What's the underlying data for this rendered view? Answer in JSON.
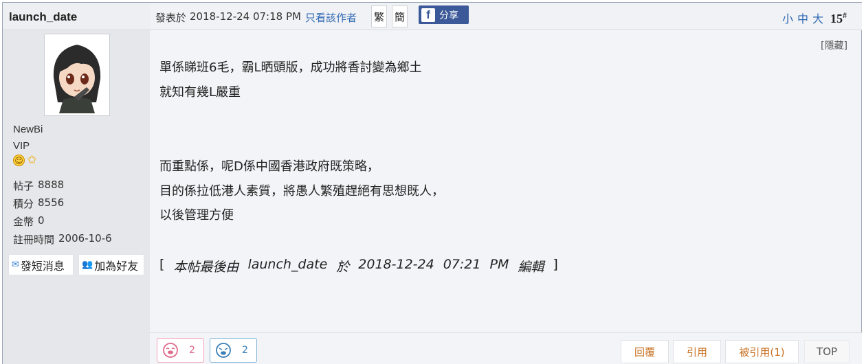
{
  "author": {
    "username": "launch_date",
    "group": "NewBi",
    "rank": "VIP",
    "badges": [
      "smile-icon",
      "star-icon"
    ],
    "stats": [
      {
        "label": "帖子",
        "value": "8888"
      },
      {
        "label": "積分",
        "value": "8556"
      },
      {
        "label": "金幣",
        "value": "0"
      },
      {
        "label": "註冊時間",
        "value": "2006-10-6"
      }
    ],
    "buttons": {
      "message_label": "發短消息",
      "add_friend_label": "加為好友"
    }
  },
  "post_header": {
    "posted_prefix": "發表於",
    "posted_time": "2018-12-24 07:18 PM",
    "only_author_label": "只看該作者",
    "traditional_label": "繁",
    "simplified_label": "簡",
    "share_label": "分享",
    "font_sizes": [
      "小",
      "中",
      "大"
    ],
    "floor_number": "15",
    "floor_mark": "#"
  },
  "post": {
    "hide_label": "[隱藏]",
    "lines": [
      "單係睇班6毛，霸L晒頭版，成功將香討變為鄉土",
      "就知有幾L嚴重",
      "而重點係，呢D係中國香港政府既策略，",
      "目的係拉低港人素質，將愚人繁殖趕絕有思想既人，",
      "以後管理方便"
    ],
    "edit_note": {
      "open": "[",
      "text_prefix": "本帖最後由",
      "editor": "launch_date",
      "at": "於",
      "date": "2018-12-24",
      "time": "07:21",
      "ampm": "PM",
      "action": "編輯",
      "close": "]"
    }
  },
  "reactions": [
    {
      "name": "like",
      "count": "2",
      "color": "#e06a8a"
    },
    {
      "name": "dislike",
      "count": "2",
      "color": "#3a7fb6"
    }
  ],
  "actions": {
    "reply_label": "回覆",
    "quote_label": "引用",
    "quoted_label": "被引用(1)",
    "top_label": "TOP"
  },
  "colors": {
    "link": "#2f69b3",
    "action": "#c86f1f",
    "facebook": "#3b5998"
  }
}
